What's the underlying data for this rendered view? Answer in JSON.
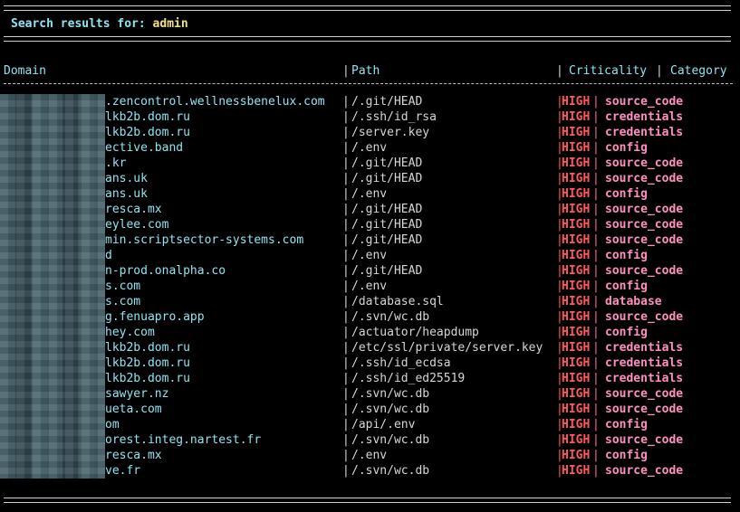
{
  "search": {
    "label": "Search results for:",
    "query": "admin"
  },
  "columns": {
    "domain": "Domain",
    "path": "Path",
    "criticality": "Criticality",
    "category": "Category"
  },
  "separator": "|",
  "rows": [
    {
      "domain": ".zencontrol.wellnessbenelux.com",
      "path": "/.git/HEAD",
      "criticality": "HIGH",
      "category": "source_code"
    },
    {
      "domain": "lkb2b.dom.ru",
      "path": "/.ssh/id_rsa",
      "criticality": "HIGH",
      "category": "credentials"
    },
    {
      "domain": "lkb2b.dom.ru",
      "path": "/server.key",
      "criticality": "HIGH",
      "category": "credentials"
    },
    {
      "domain": "ective.band",
      "path": "/.env",
      "criticality": "HIGH",
      "category": "config"
    },
    {
      "domain": ".kr",
      "path": "/.git/HEAD",
      "criticality": "HIGH",
      "category": "source_code"
    },
    {
      "domain": "ans.uk",
      "path": "/.git/HEAD",
      "criticality": "HIGH",
      "category": "source_code"
    },
    {
      "domain": "ans.uk",
      "path": "/.env",
      "criticality": "HIGH",
      "category": "config"
    },
    {
      "domain": "resca.mx",
      "path": "/.git/HEAD",
      "criticality": "HIGH",
      "category": "source_code"
    },
    {
      "domain": "eylee.com",
      "path": "/.git/HEAD",
      "criticality": "HIGH",
      "category": "source_code"
    },
    {
      "domain": "min.scriptsector-systems.com",
      "path": "/.git/HEAD",
      "criticality": "HIGH",
      "category": "source_code"
    },
    {
      "domain": "d",
      "path": "/.env",
      "criticality": "HIGH",
      "category": "config"
    },
    {
      "domain": "n-prod.onalpha.co",
      "path": "/.git/HEAD",
      "criticality": "HIGH",
      "category": "source_code"
    },
    {
      "domain": "s.com",
      "path": "/.env",
      "criticality": "HIGH",
      "category": "config"
    },
    {
      "domain": "s.com",
      "path": "/database.sql",
      "criticality": "HIGH",
      "category": "database"
    },
    {
      "domain": "g.fenuapro.app",
      "path": "/.svn/wc.db",
      "criticality": "HIGH",
      "category": "source_code"
    },
    {
      "domain": "hey.com",
      "path": "/actuator/heapdump",
      "criticality": "HIGH",
      "category": "config"
    },
    {
      "domain": "lkb2b.dom.ru",
      "path": "/etc/ssl/private/server.key",
      "criticality": "HIGH",
      "category": "credentials"
    },
    {
      "domain": "lkb2b.dom.ru",
      "path": "/.ssh/id_ecdsa",
      "criticality": "HIGH",
      "category": "credentials"
    },
    {
      "domain": "lkb2b.dom.ru",
      "path": "/.ssh/id_ed25519",
      "criticality": "HIGH",
      "category": "credentials"
    },
    {
      "domain": "sawyer.nz",
      "path": "/.svn/wc.db",
      "criticality": "HIGH",
      "category": "source_code"
    },
    {
      "domain": "ueta.com",
      "path": "/.svn/wc.db",
      "criticality": "HIGH",
      "category": "source_code"
    },
    {
      "domain": "om",
      "path": "/api/.env",
      "criticality": "HIGH",
      "category": "config"
    },
    {
      "domain": "orest.integ.nartest.fr",
      "path": "/.svn/wc.db",
      "criticality": "HIGH",
      "category": "source_code"
    },
    {
      "domain": "resca.mx",
      "path": "/.env",
      "criticality": "HIGH",
      "category": "config"
    },
    {
      "domain": "ve.fr",
      "path": "/.svn/wc.db",
      "criticality": "HIGH",
      "category": "source_code"
    }
  ]
}
